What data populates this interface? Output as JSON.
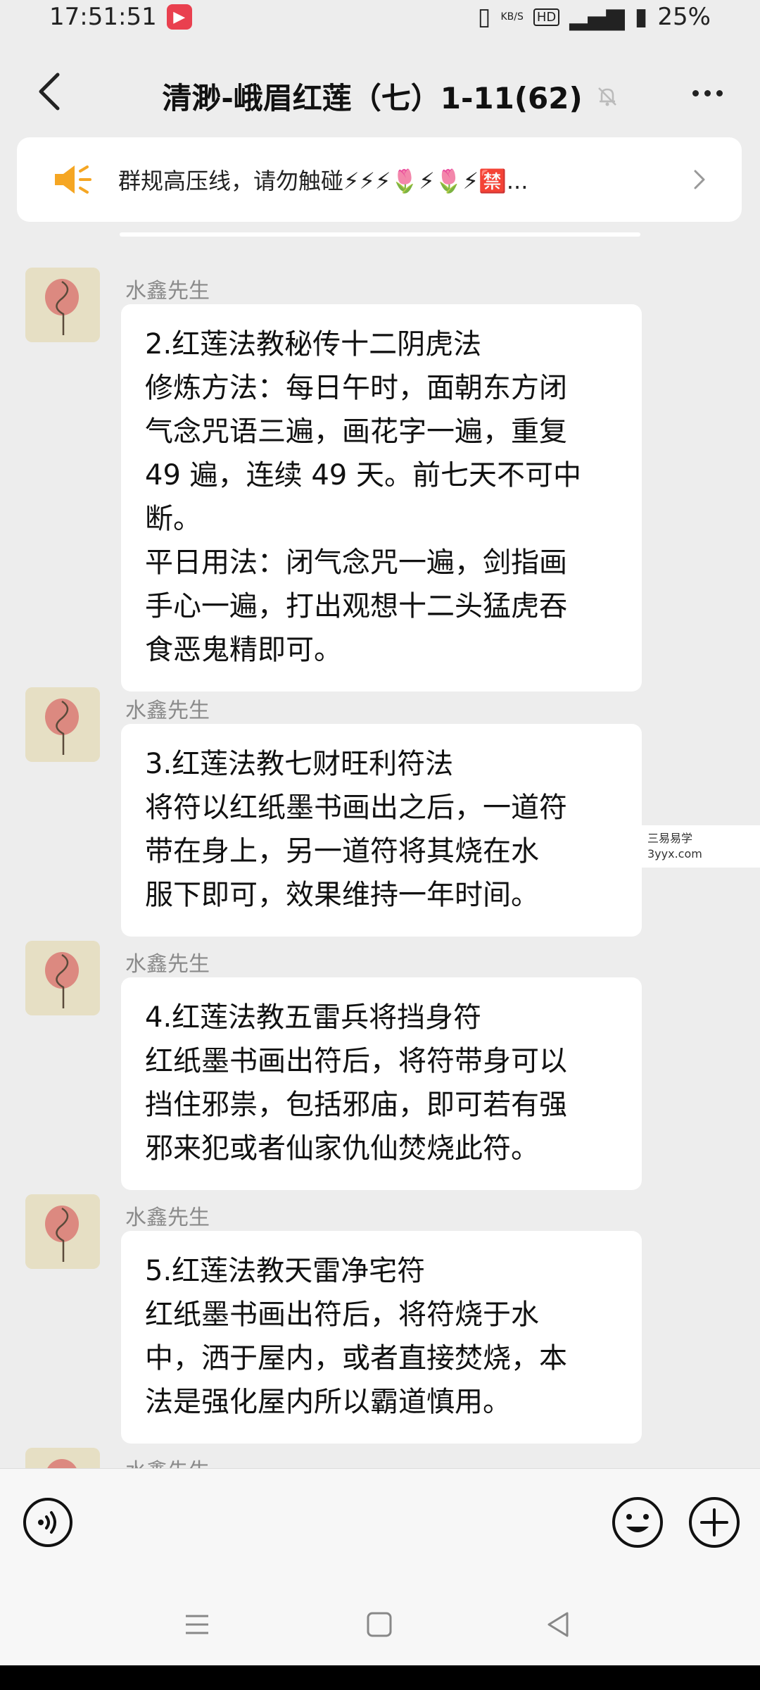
{
  "status_bar": {
    "time": "17:51:51",
    "net_speed_value": "",
    "net_speed_unit": "KB/S",
    "battery": "25%"
  },
  "header": {
    "title": "清渺-峨眉红莲（七）1-11(62)",
    "muted_icon": "bell-off-icon"
  },
  "notice": {
    "text": "群规高压线，请勿触碰⚡⚡⚡🌷⚡🌷⚡🈲..."
  },
  "messages": [
    {
      "sender": "水鑫先生",
      "lines": [
        "2.红莲法教秘传十二阴虎法",
        "修炼方法：每日午时，面朝东方闭",
        "气念咒语三遍，画花字一遍，重复",
        "49 遍，连续 49 天。前七天不可中",
        "断。",
        "平日用法：闭气念咒一遍，剑指画",
        "手心一遍，打出观想十二头猛虎吞",
        "食恶鬼精即可。"
      ]
    },
    {
      "sender": "水鑫先生",
      "lines": [
        "3.红莲法教七财旺利符法",
        "将符以红纸墨书画出之后，一道符",
        "带在身上，另一道符将其烧在水",
        "服下即可，效果维持一年时间。"
      ]
    },
    {
      "sender": "水鑫先生",
      "lines": [
        "4.红莲法教五雷兵将挡身符",
        "红纸墨书画出符后，将符带身可以",
        "挡住邪祟，包括邪庙，即可若有强",
        "邪来犯或者仙家仇仙焚烧此符。"
      ]
    },
    {
      "sender": "水鑫先生",
      "lines": [
        "5.红莲法教天雷净宅符",
        "红纸墨书画出符后，将符烧于水",
        "中，洒于屋内，或者直接焚烧，本",
        "法是强化屋内所以霸道慎用。"
      ]
    },
    {
      "sender": "水鑫先生",
      "lines": []
    }
  ],
  "watermark": {
    "line1": "三易易学",
    "line2": "3yyx.com"
  },
  "input": {
    "placeholder": ""
  }
}
